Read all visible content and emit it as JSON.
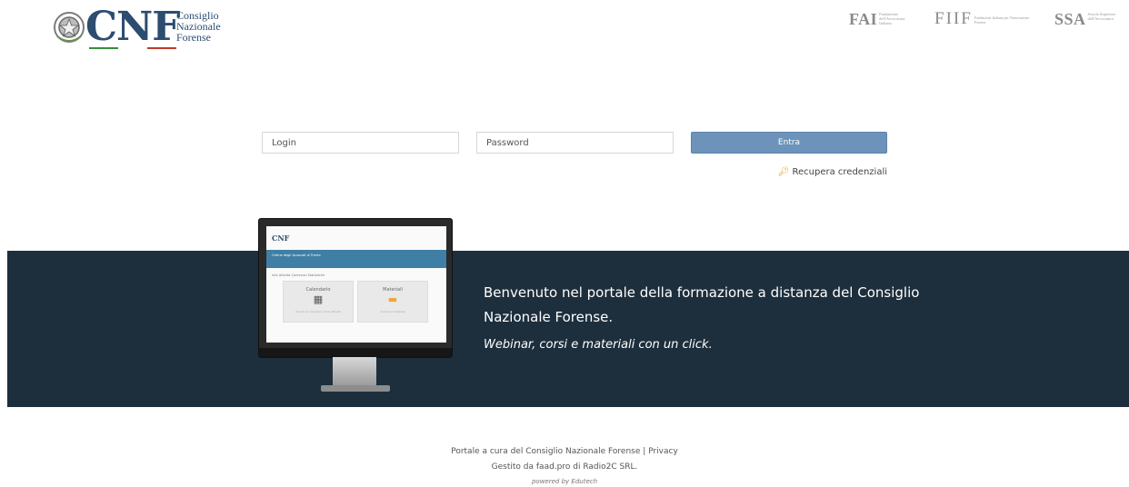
{
  "header": {
    "logo_text": "CNF",
    "logo_sub": [
      "Consiglio",
      "Nazionale",
      "Forense"
    ],
    "partners": [
      {
        "abbr": "FAI",
        "small": "Fondazione dell'Avvocatura Italiana"
      },
      {
        "abbr": "FIIF",
        "small": "Fondazione Italiana per l'Innovazione Forense"
      },
      {
        "abbr": "SSA",
        "small": "Scuola Superiore dell'Avvocatura"
      }
    ]
  },
  "login": {
    "login_placeholder": "Login",
    "password_placeholder": "Password",
    "enter_label": "Entra",
    "recover_label": "Recupera credenziali",
    "recover_icon": "key-icon"
  },
  "banner": {
    "welcome": "Benvenuto nel portale della formazione a distanza del Consiglio Nazionale Forense.",
    "tagline": "Webinar, corsi e materiali con un click.",
    "background": "#1d2f3d"
  },
  "screen_mock": {
    "logo": "CNF",
    "header_text": "Ordine degli Avvocati di Trento",
    "nav": "Info   Attività   Contenuti   Statistiche",
    "tiles": [
      {
        "title": "Calendario",
        "icon": "calendar-icon",
        "sub": "Accedi al calendario delle attività"
      },
      {
        "title": "Materiali",
        "icon": "folder-icon",
        "sub": "Accedi ai materiali"
      }
    ]
  },
  "footer": {
    "line1_text": "Portale a cura del Consiglio Nazionale Forense",
    "separator": "|",
    "privacy_label": "Privacy",
    "line2": "Gestito da faad.pro di Radio2C SRL.",
    "line3": "powered by Edutech"
  },
  "colors": {
    "brand_blue": "#2c4c70",
    "button": "#6d93ba",
    "banner": "#1d2f3d"
  }
}
